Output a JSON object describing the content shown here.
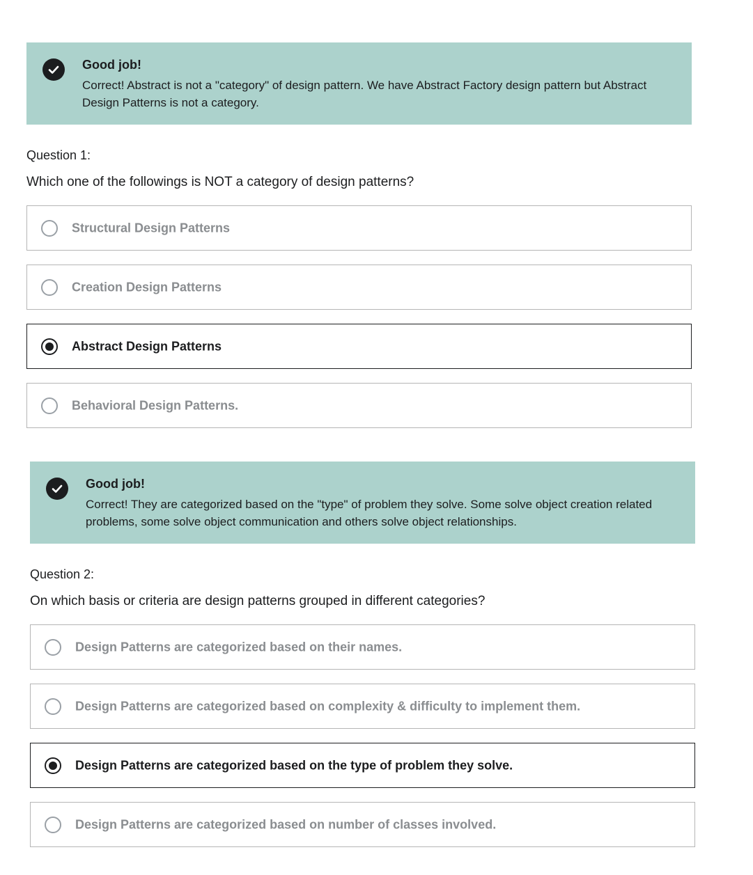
{
  "questions": [
    {
      "feedback": {
        "title": "Good job!",
        "text": "Correct! Abstract is not a \"category\" of design pattern. We have Abstract Factory design pattern but Abstract Design Patterns is not a category.",
        "icon": "check-circle-icon"
      },
      "label": "Question 1:",
      "prompt": "Which one of the followings is NOT a category of design patterns?",
      "options": [
        {
          "label": "Structural Design Patterns",
          "selected": false
        },
        {
          "label": "Creation Design Patterns",
          "selected": false
        },
        {
          "label": "Abstract Design Patterns",
          "selected": true
        },
        {
          "label": "Behavioral Design Patterns.",
          "selected": false
        }
      ]
    },
    {
      "feedback": {
        "title": "Good job!",
        "text": "Correct! They are categorized based on the \"type\" of problem they solve. Some solve object creation related problems, some solve object communication and others solve object relationships.",
        "icon": "check-circle-icon"
      },
      "label": "Question 2:",
      "prompt": "On which basis or criteria are design patterns grouped in different categories?",
      "options": [
        {
          "label": "Design Patterns are categorized based on their names.",
          "selected": false
        },
        {
          "label": "Design Patterns are categorized based on complexity & difficulty to implement them.",
          "selected": false
        },
        {
          "label": "Design Patterns are categorized based on the type of problem they solve.",
          "selected": true
        },
        {
          "label": "Design Patterns are categorized based on number of classes involved.",
          "selected": false
        }
      ]
    }
  ],
  "colors": {
    "feedback_bg": "#acd2cc",
    "text": "#1c1d1f",
    "unselected_text": "#8a8d90",
    "border": "#b5b5b5"
  }
}
